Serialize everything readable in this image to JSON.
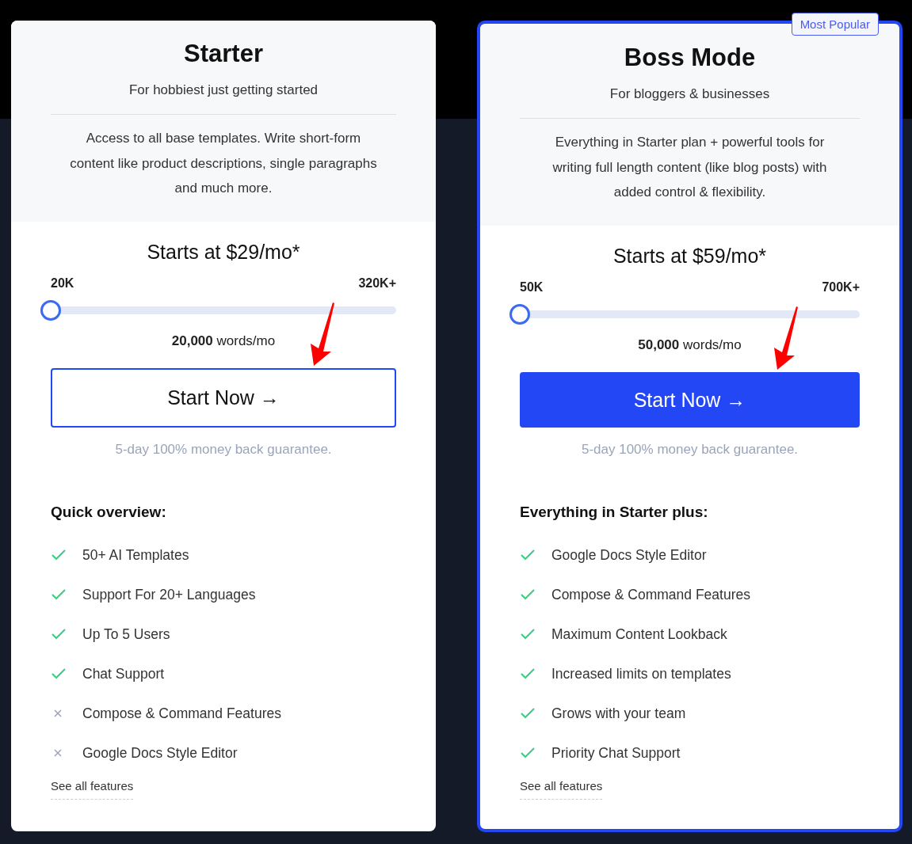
{
  "plans": [
    {
      "name": "Starter",
      "tagline": "For hobbiest just getting started",
      "description": "Access to all base templates. Write short-form content like product descriptions, single paragraphs and much more.",
      "featured": false,
      "price": "Starts at $29/mo*",
      "range_min": "20K",
      "range_max": "320K+",
      "level": 0,
      "words": "**20,000** words/mo",
      "button": "Start Now →",
      "guarantee": "5-day 100% money back guarantee.",
      "features_title": "Quick overview:",
      "features": [
        {
          "label": "50+ AI Templates",
          "included": true
        },
        {
          "label": "Support For 20+ Languages",
          "included": true
        },
        {
          "label": "Up To 5 Users",
          "included": true
        },
        {
          "label": "Chat Support",
          "included": true
        },
        {
          "label": "Compose & Command Features",
          "included": false
        },
        {
          "label": "Google Docs Style Editor",
          "included": false
        }
      ],
      "link": "See all features"
    },
    {
      "name": "Boss Mode",
      "badge": "Most Popular",
      "tagline": "For bloggers & businesses",
      "description": "Everything in Starter plan + powerful tools for writing full length content (like blog posts) with added control & flexibility.",
      "featured": true,
      "price": "Starts at $59/mo*",
      "range_min": "50K",
      "range_max": "700K+",
      "level": 0,
      "words": "**50,000** words/mo",
      "button": "Start Now →",
      "guarantee": "5-day 100% money back guarantee.",
      "features_title": "Everything in Starter plus:",
      "features": [
        {
          "label": "Google Docs Style Editor",
          "included": true
        },
        {
          "label": "Compose & Command Features",
          "included": true
        },
        {
          "label": "Maximum Content Lookback",
          "included": true
        },
        {
          "label": "Increased limits on templates",
          "included": true
        },
        {
          "label": "Grows with your team",
          "included": true
        },
        {
          "label": "Priority Chat Support",
          "included": true
        }
      ],
      "link": "See all features"
    }
  ]
}
